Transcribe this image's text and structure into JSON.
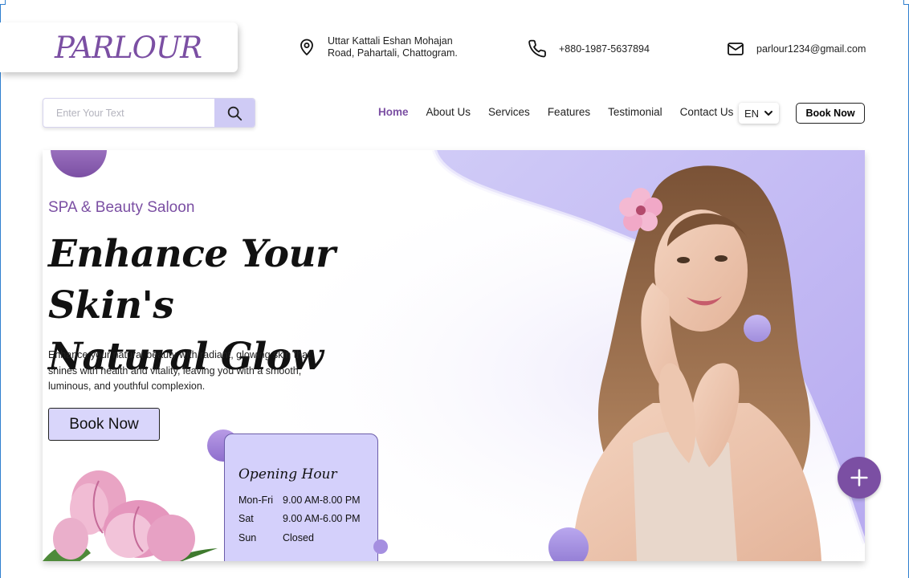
{
  "header": {
    "logo": "PARLOUR",
    "address_line1": "Uttar Kattali Eshan Mohajan",
    "address_line2": "Road, Pahartali, Chattogram.",
    "phone": "+880-1987-5637894",
    "email": "parlour1234@gmail.com"
  },
  "search": {
    "placeholder": "Enter Your Text",
    "icon": "search-icon"
  },
  "nav": {
    "items": [
      "Home",
      "About Us",
      "Services",
      "Features",
      "Testimonial",
      "Contact Us"
    ],
    "active": "Home",
    "language": "EN",
    "book_label": "Book Now"
  },
  "hero": {
    "subtitle": "SPA & Beauty Saloon",
    "headline_line1": "Enhance Your Skin's",
    "headline_line2": "Natural Glow",
    "description": "Enhance your natural beauty with radiant, glowing skin that shines with health and vitality, leaving you with a smooth, luminous, and youthful complexion.",
    "book_label": "Book Now"
  },
  "opening_hours": {
    "title": "Opening Hour",
    "rows": [
      {
        "day": "Mon-Fri",
        "time": "9.00 AM-8.00 PM"
      },
      {
        "day": "Sat",
        "time": "9.00 AM-6.00 PM"
      },
      {
        "day": "Sun",
        "time": "Closed"
      }
    ]
  },
  "colors": {
    "brand_purple": "#7b4fa3",
    "lavender": "#d4d0fb",
    "accent_blob": "#cbc5f6"
  },
  "icons": [
    "location-icon",
    "phone-icon",
    "mail-icon",
    "search-icon",
    "chevron-down-icon",
    "plus-icon"
  ]
}
